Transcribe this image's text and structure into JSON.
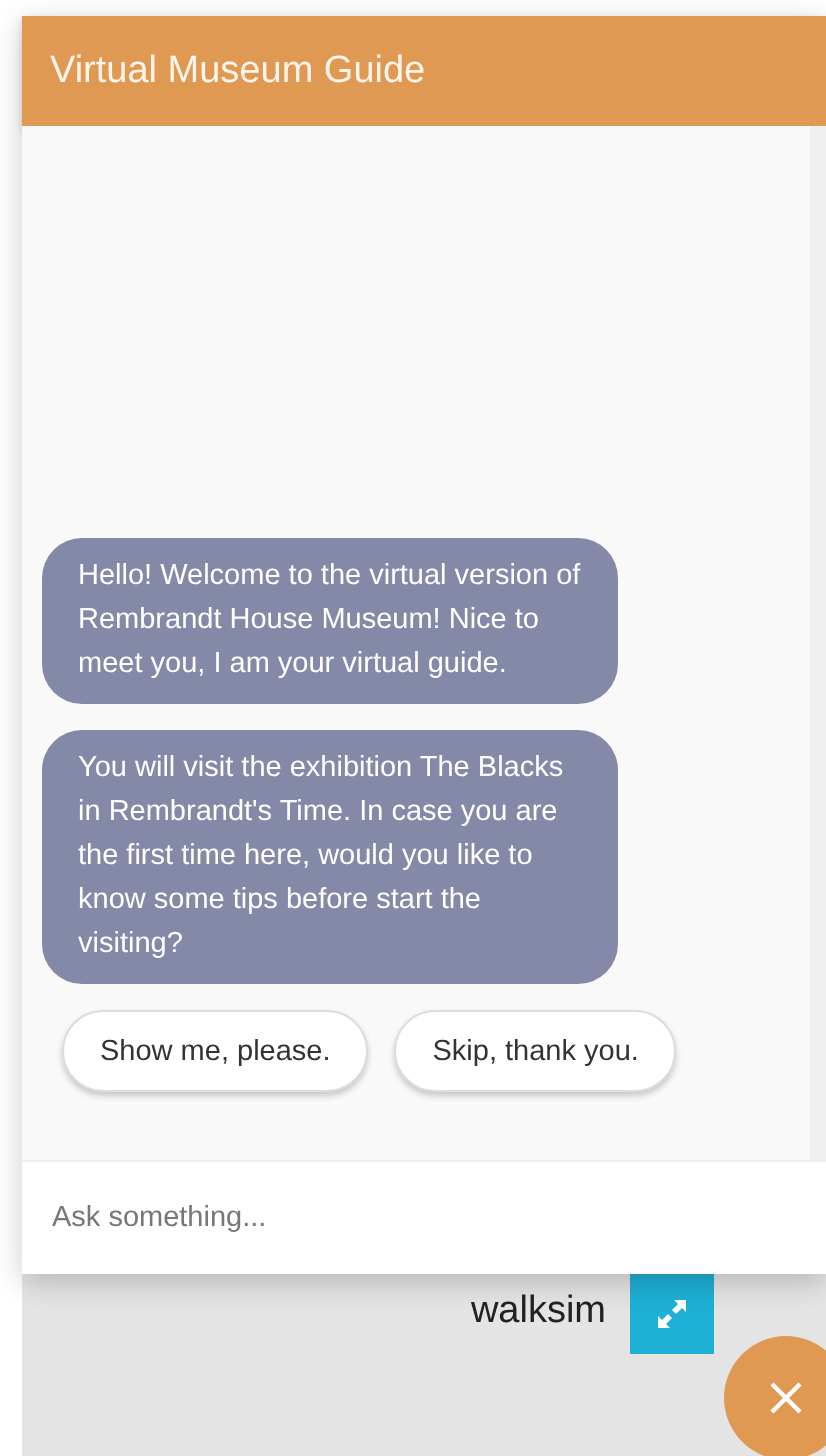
{
  "header": {
    "title": "Virtual Museum Guide"
  },
  "messages": [
    {
      "text": "Hello! Welcome to the virtual version of Rembrandt House Museum! Nice to meet you, I am your virtual guide."
    },
    {
      "text": "You will visit the exhibition The Blacks in Rembrandt's Time. In case you are the first time here, would you like to know some tips before start the visiting?"
    }
  ],
  "quick_replies": [
    "Show me, please.",
    "Skip, thank you."
  ],
  "input": {
    "placeholder": "Ask something..."
  },
  "footer": {
    "label": "walksim"
  }
}
